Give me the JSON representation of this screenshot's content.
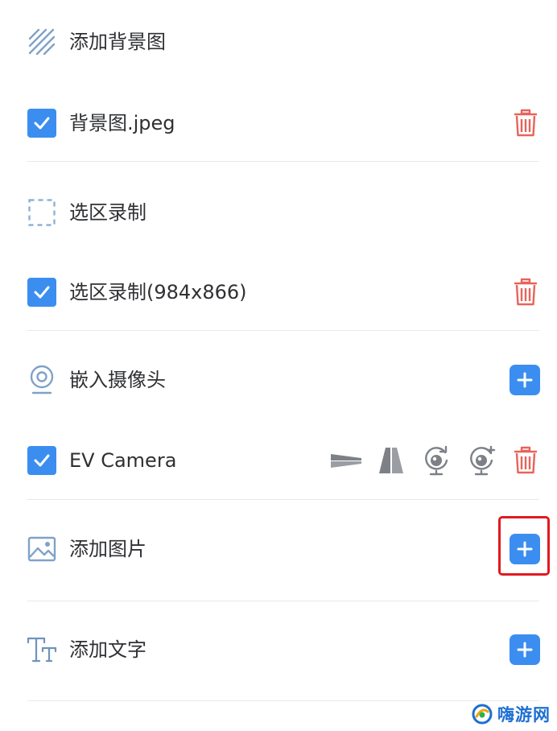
{
  "rows": {
    "add_background": {
      "label": "添加背景图",
      "icon": "background-hatch-icon"
    },
    "background_file": {
      "label": "背景图.jpeg",
      "checked": true,
      "action_icon": "trash-icon"
    },
    "region_record": {
      "label": "选区录制",
      "icon": "dashed-selection-icon"
    },
    "region_record_item": {
      "label": "选区录制(984x866)",
      "checked": true,
      "action_icon": "trash-icon"
    },
    "embed_camera": {
      "label": "嵌入摄像头",
      "icon": "webcam-icon",
      "action_icon": "plus-icon"
    },
    "ev_camera": {
      "label": "EV Camera",
      "checked": true,
      "tools": [
        "flip-horizontal-icon",
        "flip-vertical-icon",
        "rotate-left-icon",
        "rotate-right-icon"
      ],
      "action_icon": "trash-icon"
    },
    "add_image": {
      "label": "添加图片",
      "icon": "image-icon",
      "action_icon": "plus-icon",
      "highlighted": true
    },
    "add_text": {
      "label": "添加文字",
      "icon": "text-icon",
      "action_icon": "plus-icon"
    }
  },
  "watermark": {
    "text": "嗨游网"
  },
  "colors": {
    "accent": "#3b8ef0",
    "delete": "#e8635a",
    "highlight": "#e0191f",
    "divider": "#e7e9ed",
    "icon_gray": "#8a8f98"
  }
}
